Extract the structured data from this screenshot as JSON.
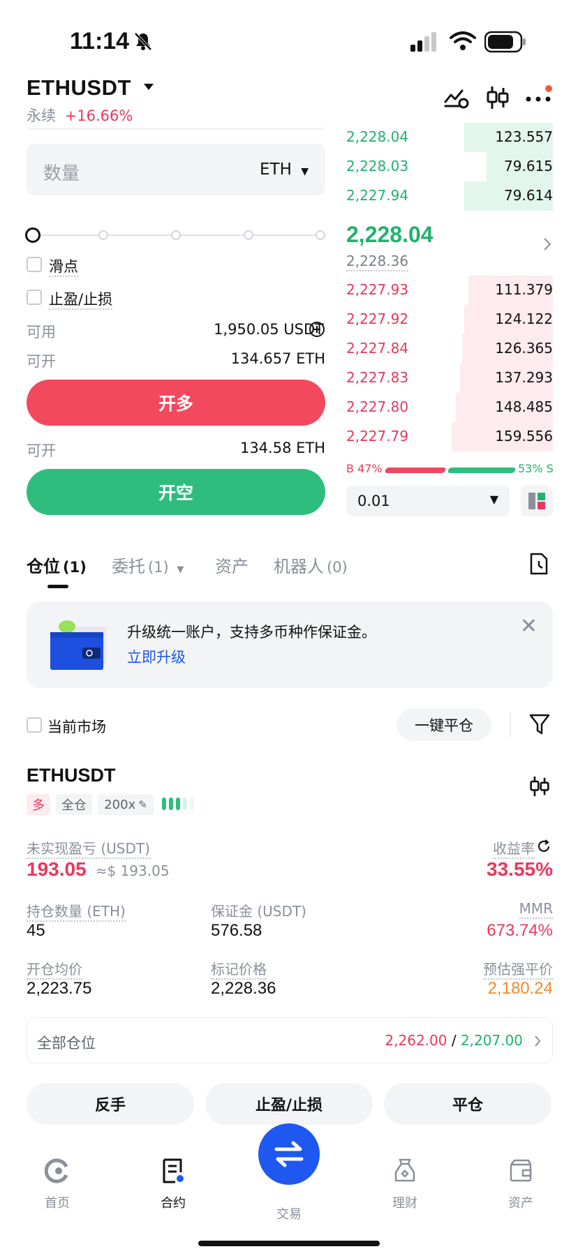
{
  "status_bar": {
    "time": "11:14"
  },
  "header": {
    "symbol": "ETHUSDT",
    "type": "永续",
    "change": "+16.66%"
  },
  "order_form": {
    "qty_placeholder": "数量",
    "qty_unit": "ETH",
    "slippage_label": "滑点",
    "tpsl_label": "止盈/止损",
    "available_label": "可用",
    "available_value": "1,950.05 USDT",
    "can_open_label": "可开",
    "can_open_long": "134.657 ETH",
    "long_button": "开多",
    "can_open_short": "134.58 ETH",
    "short_button": "开空"
  },
  "orderbook": {
    "asks": [
      {
        "price": "2,228.04",
        "qty": "123.557",
        "depth": 0.43
      },
      {
        "price": "2,228.03",
        "qty": "79.615",
        "depth": 0.32
      },
      {
        "price": "2,227.94",
        "qty": "79.614",
        "depth": 0.43
      }
    ],
    "last_price": "2,228.04",
    "mark_price": "2,228.36",
    "bids": [
      {
        "price": "2,227.93",
        "qty": "111.379",
        "depth": 0.41
      },
      {
        "price": "2,227.92",
        "qty": "124.122",
        "depth": 0.43
      },
      {
        "price": "2,227.84",
        "qty": "126.365",
        "depth": 0.44
      },
      {
        "price": "2,227.83",
        "qty": "137.293",
        "depth": 0.45
      },
      {
        "price": "2,227.80",
        "qty": "148.485",
        "depth": 0.47
      },
      {
        "price": "2,227.79",
        "qty": "159.556",
        "depth": 0.49
      }
    ],
    "buy_ratio": "B 47%",
    "sell_ratio": "53% S",
    "precision": "0.01"
  },
  "tabs": [
    {
      "label": "仓位",
      "count": "(1)"
    },
    {
      "label": "委托",
      "count": "(1)"
    },
    {
      "label": "资产",
      "count": ""
    },
    {
      "label": "机器人",
      "count": "(0)"
    }
  ],
  "banner": {
    "text": "升级统一账户，支持多币种作保证金。",
    "link": "立即升级"
  },
  "filter": {
    "current_market": "当前市场",
    "close_all": "一键平仓"
  },
  "position": {
    "symbol": "ETHUSDT",
    "side": "多",
    "margin_mode": "全仓",
    "leverage": "200x",
    "upnl_label": "未实现盈亏 (USDT)",
    "upnl_value": "193.05",
    "upnl_approx": "≈$ 193.05",
    "roe_label": "收益率",
    "roe_value": "33.55%",
    "size_label": "持仓数量 (ETH)",
    "size_value": "45",
    "margin_label": "保证金 (USDT)",
    "margin_value": "576.58",
    "mmr_label": "MMR",
    "mmr_value": "673.74%",
    "entry_label": "开仓均价",
    "entry_value": "2,223.75",
    "mark_label": "标记价格",
    "mark_value": "2,228.36",
    "liq_label": "预估强平价",
    "liq_value": "2,180.24",
    "all_positions_label": "全部仓位",
    "tp_value": "2,262.00",
    "separator": "/",
    "sl_value": "2,207.00",
    "reverse_button": "反手",
    "tpsl_button": "止盈/止损",
    "close_button": "平仓"
  },
  "nav": {
    "home": "首页",
    "contract": "合约",
    "trade": "交易",
    "finance": "理财",
    "assets": "资产"
  },
  "colors": {
    "green": "#20b26c",
    "red": "#e8385c",
    "orange": "#f08a2c",
    "blue": "#1f58f0"
  }
}
